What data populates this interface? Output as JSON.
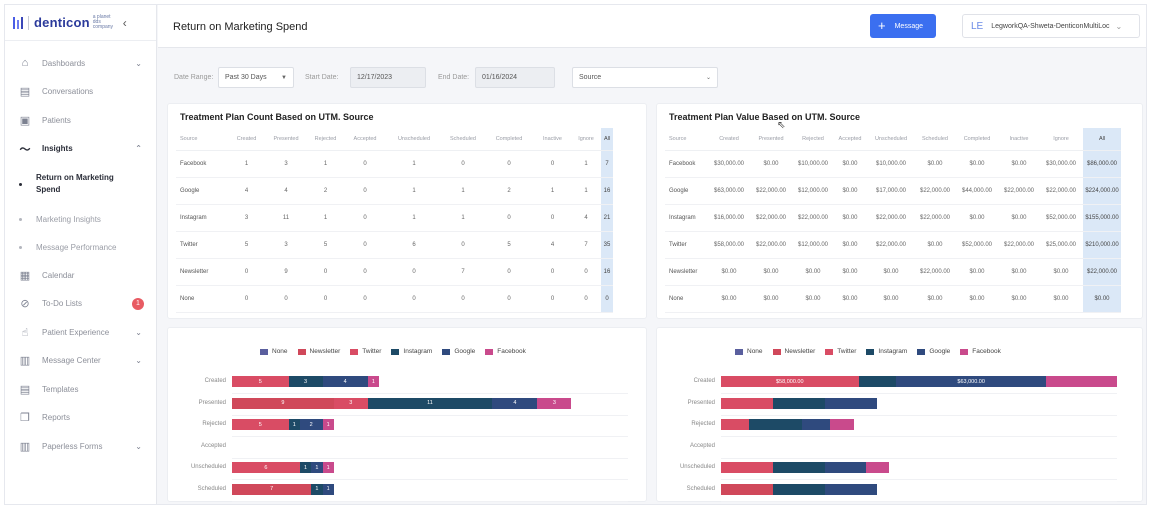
{
  "brand": {
    "name": "denticon",
    "sub": "a planet dds company"
  },
  "sidebar": {
    "items": [
      {
        "label": "Dashboards",
        "chevron": true
      },
      {
        "label": "Conversations",
        "chevron": false
      },
      {
        "label": "Patients",
        "chevron": false
      },
      {
        "label": "Insights",
        "chevron": true,
        "active": true
      },
      {
        "label": "Calendar",
        "chevron": false
      },
      {
        "label": "To-Do Lists",
        "chevron": false,
        "badge": "1"
      },
      {
        "label": "Patient Experience",
        "chevron": true
      },
      {
        "label": "Message Center",
        "chevron": true
      },
      {
        "label": "Templates",
        "chevron": false
      },
      {
        "label": "Reports",
        "chevron": false
      },
      {
        "label": "Paperless Forms",
        "chevron": true
      }
    ],
    "insights_sub": [
      {
        "label": "Return on Marketing Spend",
        "active": true
      },
      {
        "label": "Marketing Insights"
      },
      {
        "label": "Message Performance"
      }
    ]
  },
  "header": {
    "title": "Return on Marketing Spend",
    "message_button": "Message",
    "user_initials": "LE",
    "user_name": "LegworkQA-Shweta-DenticonMultiLoc"
  },
  "filters": {
    "date_range_label": "Date Range:",
    "date_range_value": "Past 30 Days",
    "start_label": "Start Date:",
    "start_value": "12/17/2023",
    "end_label": "End Date:",
    "end_value": "01/16/2024",
    "source_value": "Source"
  },
  "count_table": {
    "title": "Treatment Plan Count Based on UTM. Source",
    "headers": [
      "Source",
      "Created",
      "Presented",
      "Rejected",
      "Accepted",
      "Unscheduled",
      "Scheduled",
      "Completed",
      "Inactive",
      "Ignore",
      "All"
    ],
    "rows": [
      [
        "Facebook",
        "1",
        "3",
        "1",
        "0",
        "1",
        "0",
        "0",
        "0",
        "1",
        "7"
      ],
      [
        "Google",
        "4",
        "4",
        "2",
        "0",
        "1",
        "1",
        "2",
        "1",
        "1",
        "16"
      ],
      [
        "Instagram",
        "3",
        "11",
        "1",
        "0",
        "1",
        "1",
        "0",
        "0",
        "4",
        "21"
      ],
      [
        "Twitter",
        "5",
        "3",
        "5",
        "0",
        "6",
        "0",
        "5",
        "4",
        "7",
        "35"
      ],
      [
        "Newsletter",
        "0",
        "9",
        "0",
        "0",
        "0",
        "7",
        "0",
        "0",
        "0",
        "16"
      ],
      [
        "None",
        "0",
        "0",
        "0",
        "0",
        "0",
        "0",
        "0",
        "0",
        "0",
        "0"
      ]
    ]
  },
  "value_table": {
    "title": "Treatment Plan Value Based on UTM. Source",
    "headers": [
      "Source",
      "Created",
      "Presented",
      "Rejected",
      "Accepted",
      "Unscheduled",
      "Scheduled",
      "Completed",
      "Inactive",
      "Ignore",
      "All"
    ],
    "rows": [
      [
        "Facebook",
        "$30,000.00",
        "$0.00",
        "$10,000.00",
        "$0.00",
        "$10,000.00",
        "$0.00",
        "$0.00",
        "$0.00",
        "$30,000.00",
        "$86,000.00"
      ],
      [
        "Google",
        "$63,000.00",
        "$22,000.00",
        "$12,000.00",
        "$0.00",
        "$17,000.00",
        "$22,000.00",
        "$44,000.00",
        "$22,000.00",
        "$22,000.00",
        "$224,000.00"
      ],
      [
        "Instagram",
        "$16,000.00",
        "$22,000.00",
        "$22,000.00",
        "$0.00",
        "$22,000.00",
        "$22,000.00",
        "$0.00",
        "$0.00",
        "$52,000.00",
        "$155,000.00"
      ],
      [
        "Twitter",
        "$58,000.00",
        "$22,000.00",
        "$12,000.00",
        "$0.00",
        "$22,000.00",
        "$0.00",
        "$52,000.00",
        "$22,000.00",
        "$25,000.00",
        "$210,000.00"
      ],
      [
        "Newsletter",
        "$0.00",
        "$0.00",
        "$0.00",
        "$0.00",
        "$0.00",
        "$22,000.00",
        "$0.00",
        "$0.00",
        "$0.00",
        "$22,000.00"
      ],
      [
        "None",
        "$0.00",
        "$0.00",
        "$0.00",
        "$0.00",
        "$0.00",
        "$0.00",
        "$0.00",
        "$0.00",
        "$0.00",
        "$0.00"
      ]
    ]
  },
  "legend": [
    {
      "name": "None",
      "color": "#5a5f9e"
    },
    {
      "name": "Newsletter",
      "color": "#d0485a"
    },
    {
      "name": "Twitter",
      "color": "#d94c64"
    },
    {
      "name": "Instagram",
      "color": "#1d4a66"
    },
    {
      "name": "Google",
      "color": "#2f4a7e"
    },
    {
      "name": "Facebook",
      "color": "#c94a8c"
    }
  ],
  "chart_data": [
    {
      "type": "bar",
      "orientation": "horizontal-stacked",
      "categories": [
        "Created",
        "Presented",
        "Rejected",
        "Accepted",
        "Unscheduled",
        "Scheduled"
      ],
      "series": [
        {
          "name": "None",
          "values": [
            0,
            0,
            0,
            0,
            0,
            0
          ]
        },
        {
          "name": "Newsletter",
          "values": [
            0,
            9,
            0,
            0,
            0,
            7
          ]
        },
        {
          "name": "Twitter",
          "values": [
            5,
            3,
            5,
            0,
            6,
            0
          ]
        },
        {
          "name": "Instagram",
          "values": [
            3,
            11,
            1,
            0,
            1,
            1
          ]
        },
        {
          "name": "Google",
          "values": [
            4,
            4,
            2,
            0,
            1,
            1
          ]
        },
        {
          "name": "Facebook",
          "values": [
            1,
            3,
            1,
            0,
            1,
            0
          ]
        }
      ],
      "max": 35
    },
    {
      "type": "bar",
      "orientation": "horizontal-stacked",
      "categories": [
        "Created",
        "Presented",
        "Rejected",
        "Accepted",
        "Unscheduled",
        "Scheduled"
      ],
      "series": [
        {
          "name": "None",
          "values": [
            0,
            0,
            0,
            0,
            0,
            0
          ]
        },
        {
          "name": "Newsletter",
          "values": [
            0,
            0,
            0,
            0,
            0,
            22000
          ]
        },
        {
          "name": "Twitter",
          "values": [
            58000,
            22000,
            12000,
            0,
            22000,
            0
          ]
        },
        {
          "name": "Instagram",
          "values": [
            16000,
            22000,
            22000,
            0,
            22000,
            22000
          ]
        },
        {
          "name": "Google",
          "values": [
            63000,
            22000,
            12000,
            0,
            17000,
            22000
          ]
        },
        {
          "name": "Facebook",
          "values": [
            30000,
            0,
            10000,
            0,
            10000,
            0
          ]
        }
      ],
      "labels": {
        "Created": {
          "Twitter": "$58,000.00",
          "Google": "$63,000.00"
        }
      },
      "max": 167000
    }
  ]
}
